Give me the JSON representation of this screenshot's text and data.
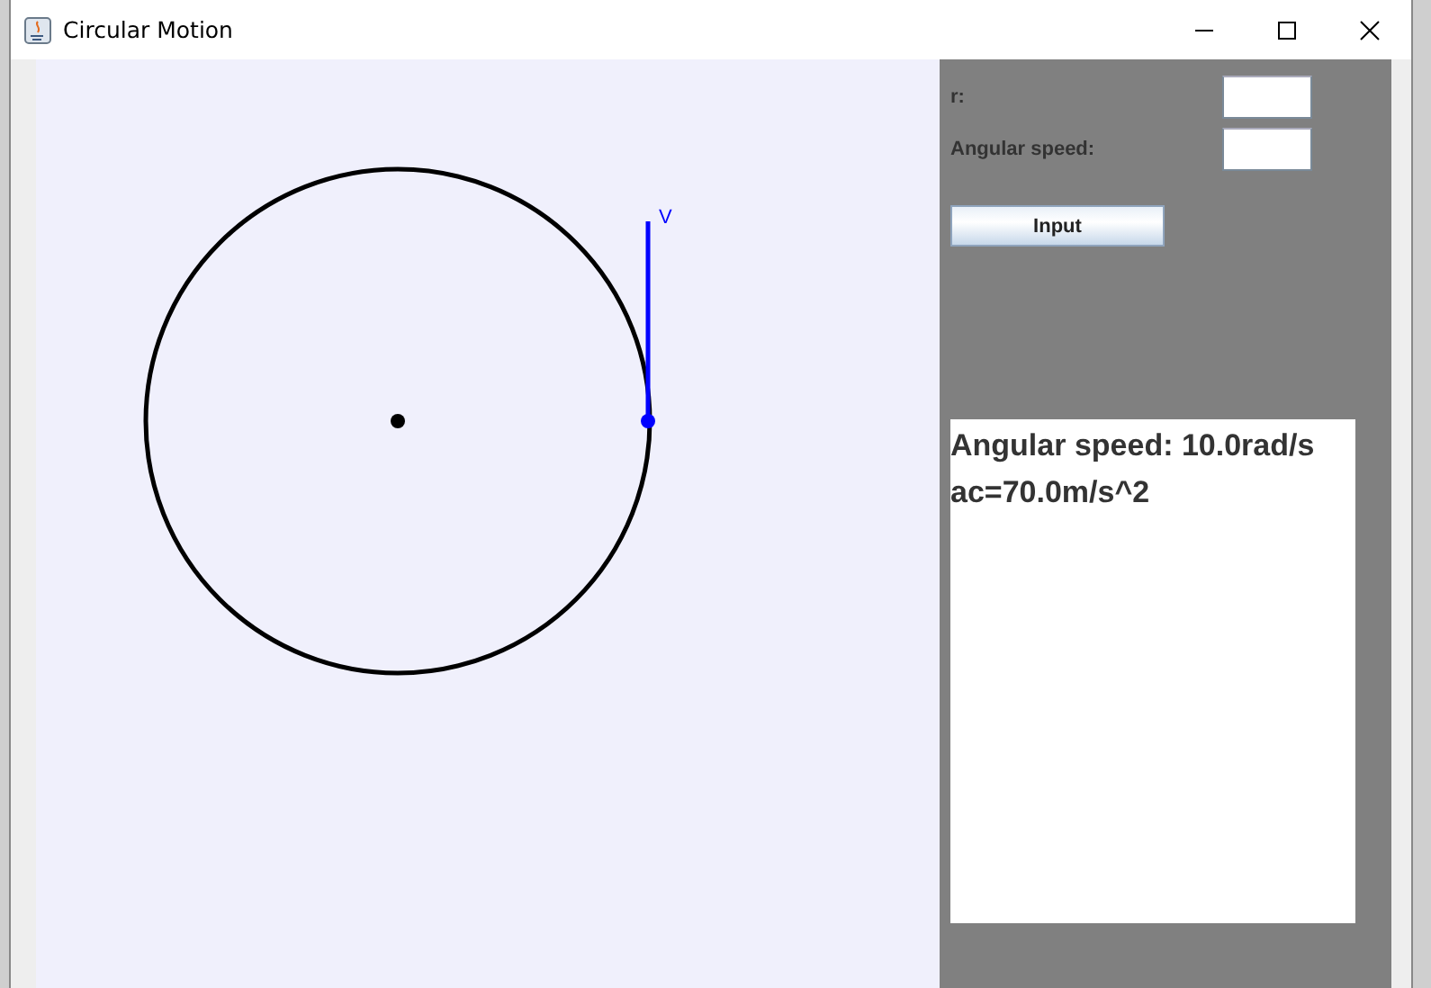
{
  "window": {
    "title": "Circular Motion"
  },
  "canvas": {
    "velocity_label": "V"
  },
  "fields": [
    {
      "label": "r:"
    },
    {
      "label": "Angular speed:"
    }
  ],
  "button": "Input",
  "output": [
    "Angular speed: 10.0rad/s",
    "ac=70.0m/s^2"
  ]
}
